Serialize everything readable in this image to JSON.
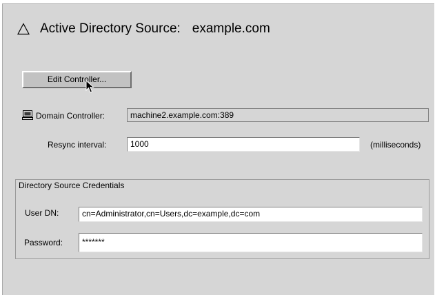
{
  "header": {
    "title_label": "Active Directory Source:",
    "title_value": "example.com"
  },
  "controller": {
    "edit_button_label": "Edit Controller..."
  },
  "form": {
    "domain_controller_label": "Domain Controller:",
    "domain_controller_value": "machine2.example.com:389",
    "resync_label": "Resync interval:",
    "resync_value": "1000",
    "resync_unit": "(milliseconds)"
  },
  "credentials": {
    "group_title": "Directory Source Credentials",
    "user_dn_label": "User DN:",
    "user_dn_value": "cn=Administrator,cn=Users,dc=example,dc=com",
    "password_label": "Password:",
    "password_value": "*******"
  },
  "icons": {
    "title_icon": "warning-triangle-icon",
    "domain_controller_icon": "computer-icon",
    "cursor": "mouse-pointer-icon"
  }
}
